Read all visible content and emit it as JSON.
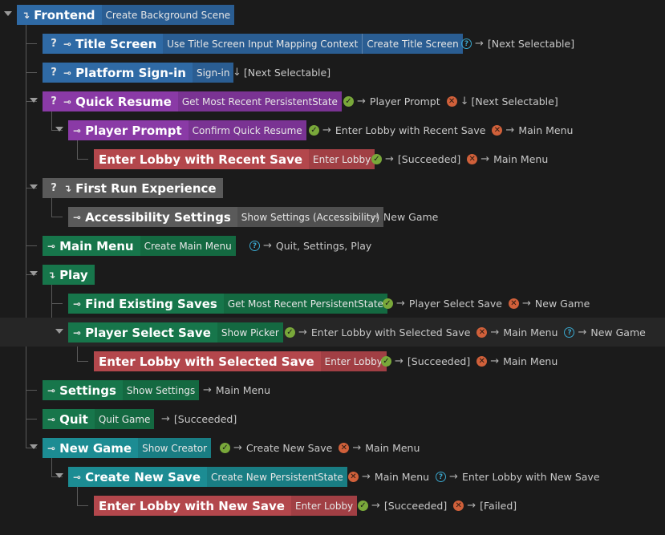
{
  "rows": [
    {
      "title": "Frontend",
      "icon": "branch",
      "actions": [
        "Create Background Scene"
      ],
      "transitions": []
    },
    {
      "title": "Title Screen",
      "icon": "question-key",
      "actions": [
        "Use Title Screen Input Mapping Context",
        "Create Title Screen"
      ],
      "transitions": [
        {
          "icon": "question",
          "arrow": "→",
          "text": "[Next Selectable]"
        }
      ]
    },
    {
      "title": "Platform Sign-in",
      "icon": "question-key",
      "actions": [
        "Sign-in"
      ],
      "transitions": [
        {
          "icon": "",
          "arrow": "↓",
          "text": "[Next Selectable]"
        }
      ]
    },
    {
      "title": "Quick Resume",
      "icon": "question-key",
      "actions": [
        "Get Most Recent PersistentState"
      ],
      "transitions": [
        {
          "icon": "ok",
          "arrow": "→",
          "text": "Player Prompt"
        },
        {
          "icon": "err",
          "arrow": "↓",
          "text": "[Next Selectable]"
        }
      ]
    },
    {
      "title": "Player Prompt",
      "icon": "key",
      "actions": [
        "Confirm Quick Resume"
      ],
      "transitions": [
        {
          "icon": "ok",
          "arrow": "→",
          "text": "Enter Lobby with Recent Save"
        },
        {
          "icon": "err",
          "arrow": "→",
          "text": "Main Menu"
        }
      ]
    },
    {
      "title": "Enter Lobby with Recent Save",
      "icon": "",
      "actions": [
        "Enter Lobby"
      ],
      "transitions": [
        {
          "icon": "ok",
          "arrow": "→",
          "text": "[Succeeded]"
        },
        {
          "icon": "err",
          "arrow": "→",
          "text": "Main Menu"
        }
      ]
    },
    {
      "title": "First Run Experience",
      "icon": "question-branch",
      "actions": [],
      "transitions": []
    },
    {
      "title": "Accessibility Settings",
      "icon": "key",
      "actions": [
        "Show Settings (Accessibility)"
      ],
      "transitions": [
        {
          "icon": "",
          "arrow": "→",
          "text": "New Game"
        }
      ]
    },
    {
      "title": "Main Menu",
      "icon": "key",
      "actions": [
        "Create Main Menu"
      ],
      "transitions": [
        {
          "icon": "question",
          "arrow": "→",
          "text": "Quit, Settings, Play"
        }
      ]
    },
    {
      "title": "Play",
      "icon": "branch",
      "actions": [],
      "transitions": []
    },
    {
      "title": "Find Existing Saves",
      "icon": "key",
      "actions": [
        "Get Most Recent PersistentState"
      ],
      "transitions": [
        {
          "icon": "ok",
          "arrow": "→",
          "text": "Player Select Save"
        },
        {
          "icon": "err",
          "arrow": "→",
          "text": "New Game"
        }
      ]
    },
    {
      "title": "Player Select Save",
      "icon": "key",
      "actions": [
        "Show Picker"
      ],
      "transitions": [
        {
          "icon": "ok",
          "arrow": "→",
          "text": "Enter Lobby with Selected Save"
        },
        {
          "icon": "err",
          "arrow": "→",
          "text": "Main Menu"
        },
        {
          "icon": "question",
          "arrow": "→",
          "text": "New Game"
        }
      ]
    },
    {
      "title": "Enter Lobby with Selected Save",
      "icon": "",
      "actions": [
        "Enter Lobby"
      ],
      "transitions": [
        {
          "icon": "ok",
          "arrow": "→",
          "text": "[Succeeded]"
        },
        {
          "icon": "err",
          "arrow": "→",
          "text": "Main Menu"
        }
      ]
    },
    {
      "title": "Settings",
      "icon": "key",
      "actions": [
        "Show Settings"
      ],
      "transitions": [
        {
          "icon": "",
          "arrow": "→",
          "text": "Main Menu"
        }
      ]
    },
    {
      "title": "Quit",
      "icon": "key",
      "actions": [
        "Quit Game"
      ],
      "transitions": [
        {
          "icon": "",
          "arrow": "→",
          "text": "[Succeeded]"
        }
      ]
    },
    {
      "title": "New Game",
      "icon": "key",
      "actions": [
        "Show Creator"
      ],
      "transitions": [
        {
          "icon": "ok",
          "arrow": "→",
          "text": "Create New Save"
        },
        {
          "icon": "err",
          "arrow": "→",
          "text": "Main Menu"
        }
      ]
    },
    {
      "title": "Create New Save",
      "icon": "key",
      "actions": [
        "Create New PersistentState"
      ],
      "transitions": [
        {
          "icon": "err",
          "arrow": "→",
          "text": "Main Menu"
        },
        {
          "icon": "question",
          "arrow": "→",
          "text": "Enter Lobby with New Save"
        }
      ]
    },
    {
      "title": "Enter Lobby with New Save",
      "icon": "",
      "actions": [
        "Enter Lobby"
      ],
      "transitions": [
        {
          "icon": "ok",
          "arrow": "→",
          "text": "[Succeeded]"
        },
        {
          "icon": "err",
          "arrow": "→",
          "text": "[Failed]"
        }
      ]
    }
  ],
  "colors": {
    "blue": "#2f6aa5",
    "purple": "#8a3aa6",
    "red": "#b3474c",
    "gray": "#5a5a5a",
    "green": "#17764b",
    "teal": "#1c8c93"
  }
}
